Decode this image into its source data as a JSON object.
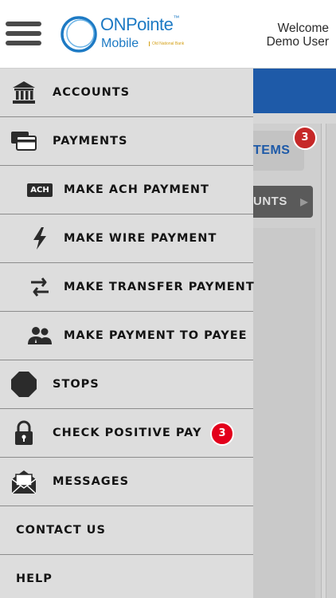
{
  "header": {
    "brand_top": "ONPointe",
    "brand_tm": "™",
    "brand_bottom": "Mobile",
    "brand_sub": "Old National Bank",
    "welcome_line1": "Welcome",
    "welcome_line2": "Demo User"
  },
  "background": {
    "items_label": "TEMS",
    "items_badge": "3",
    "accounts_label": "UNTS",
    "accounts_arrow": "▶"
  },
  "menu": {
    "accounts": "ACCOUNTS",
    "payments": "PAYMENTS",
    "ach": "MAKE ACH PAYMENT",
    "ach_icon_text": "ACH",
    "wire": "MAKE WIRE PAYMENT",
    "transfer": "MAKE TRANSFER PAYMENT",
    "payee": "MAKE PAYMENT TO PAYEE",
    "stops": "STOPS",
    "positive_pay": "CHECK POSITIVE PAY",
    "positive_pay_badge": "3",
    "messages": "MESSAGES",
    "contact": "CONTACT US",
    "help": "HELP"
  },
  "colors": {
    "brand": "#1d7ac4",
    "header_blue": "#1e5aa8",
    "badge_red": "#e3001b",
    "drawer_bg": "#dddddd"
  }
}
